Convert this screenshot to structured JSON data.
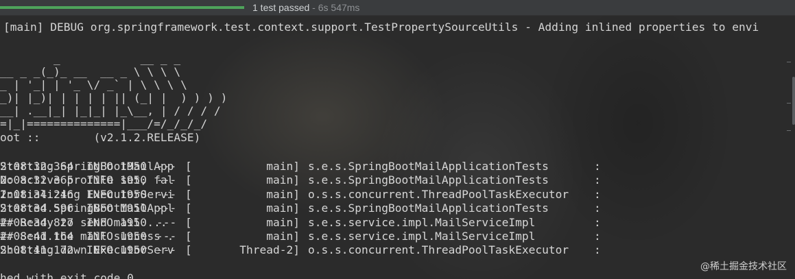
{
  "test_run": {
    "progress_fraction": 1.0,
    "progress_color": "#4ea45b",
    "status_text": "1 test passed",
    "separator": " - ",
    "duration": "6s 547ms"
  },
  "console": {
    "debug_line": "[main] DEBUG org.springframework.test.context.support.TestPropertySourceUtils - Adding inlined properties to envi",
    "banner": [
      "        _            __ _ _",
      "__ _ _(_)_ __  __ _ \\ \\ \\ \\",
      "_ | '_| | '_ \\/ _` | \\ \\ \\ \\",
      "_)| |_)| | | | | || (_| |  ) ) ) )",
      "__| .__|_| |_|_| |_\\__, | / / / /",
      "=|_|==============|___/=/_/_/_/",
      "oot ::        (v2.1.2.RELEASE)"
    ],
    "log_rows": [
      {
        "time": "2:08:32.364",
        "level": "INFO",
        "pid": "1950",
        "dash": "---",
        "bracket": "[",
        "thread": "main]",
        "logger": "s.e.s.SpringBootMailApplicationTests",
        "colon": ":",
        "message": "Starting SpringBootMailApp"
      },
      {
        "time": "2:08:32.365",
        "level": "INFO",
        "pid": "1950",
        "dash": "---",
        "bracket": "[",
        "thread": "main]",
        "logger": "s.e.s.SpringBootMailApplicationTests",
        "colon": ":",
        "message": "No active profile set, fal"
      },
      {
        "time": "2:08:34.246",
        "level": "INFO",
        "pid": "1950",
        "dash": "---",
        "bracket": "[",
        "thread": "main]",
        "logger": "o.s.s.concurrent.ThreadPoolTaskExecutor",
        "colon": ":",
        "message": "Initializing ExecutorServi"
      },
      {
        "time": "2:08:34.596",
        "level": "INFO",
        "pid": "1950",
        "dash": "---",
        "bracket": "[",
        "thread": "main]",
        "logger": "s.e.s.SpringBootMailApplicationTests",
        "colon": ":",
        "message": "Started SpringBootMailAppl"
      },
      {
        "time": "2:08:34.827",
        "level": "INFO",
        "pid": "1950",
        "dash": "---",
        "bracket": "[",
        "thread": "main]",
        "logger": "s.e.s.service.impl.MailServiceImpl",
        "colon": ":",
        "message": "## Ready to send mail ..."
      },
      {
        "time": "2:08:41.164",
        "level": "INFO",
        "pid": "1950",
        "dash": "---",
        "bracket": "[",
        "thread": "main]",
        "logger": "s.e.s.service.impl.MailServiceImpl",
        "colon": ":",
        "message": "## Send the mail success ."
      },
      {
        "time": "2:08:41.172",
        "level": "INFO",
        "pid": "1950",
        "dash": "---",
        "bracket": "[",
        "thread": "Thread-2]",
        "logger": "o.s.s.concurrent.ThreadPoolTaskExecutor",
        "colon": ":",
        "message": "Shutting down ExecutorServ"
      }
    ],
    "exit_line": "hed with exit code 0"
  },
  "watermark": "@稀土掘金技术社区"
}
